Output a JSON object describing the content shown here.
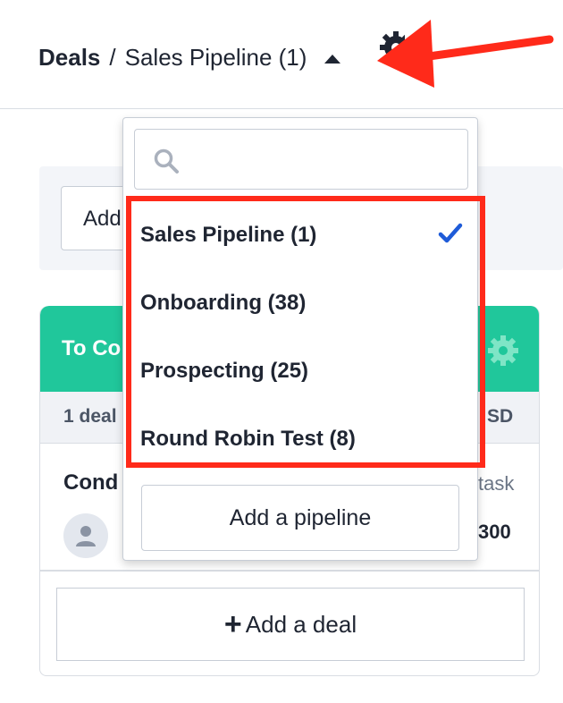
{
  "header": {
    "breadcrumb_root": "Deals",
    "separator": "/",
    "current_pipeline": "Sales Pipeline (1)"
  },
  "toolbar": {
    "add_label": "Add"
  },
  "stage": {
    "title": "To Co",
    "deal_count": "1 deal",
    "currency": "SD",
    "color": "#20c79b"
  },
  "deal_card": {
    "title": "Cond",
    "task": "task",
    "value": "300"
  },
  "add_deal": {
    "plus": "+",
    "label": "Add a deal"
  },
  "dropdown": {
    "search_placeholder": "",
    "options": [
      {
        "label": "Sales Pipeline (1)",
        "selected": true
      },
      {
        "label": "Onboarding (38)",
        "selected": false
      },
      {
        "label": "Prospecting (25)",
        "selected": false
      },
      {
        "label": "Round Robin Test (8)",
        "selected": false
      }
    ],
    "add_pipeline_label": "Add a pipeline"
  },
  "annotations": {
    "highlight_color": "#ff2a1a",
    "arrow_color": "#ff2a1a"
  }
}
